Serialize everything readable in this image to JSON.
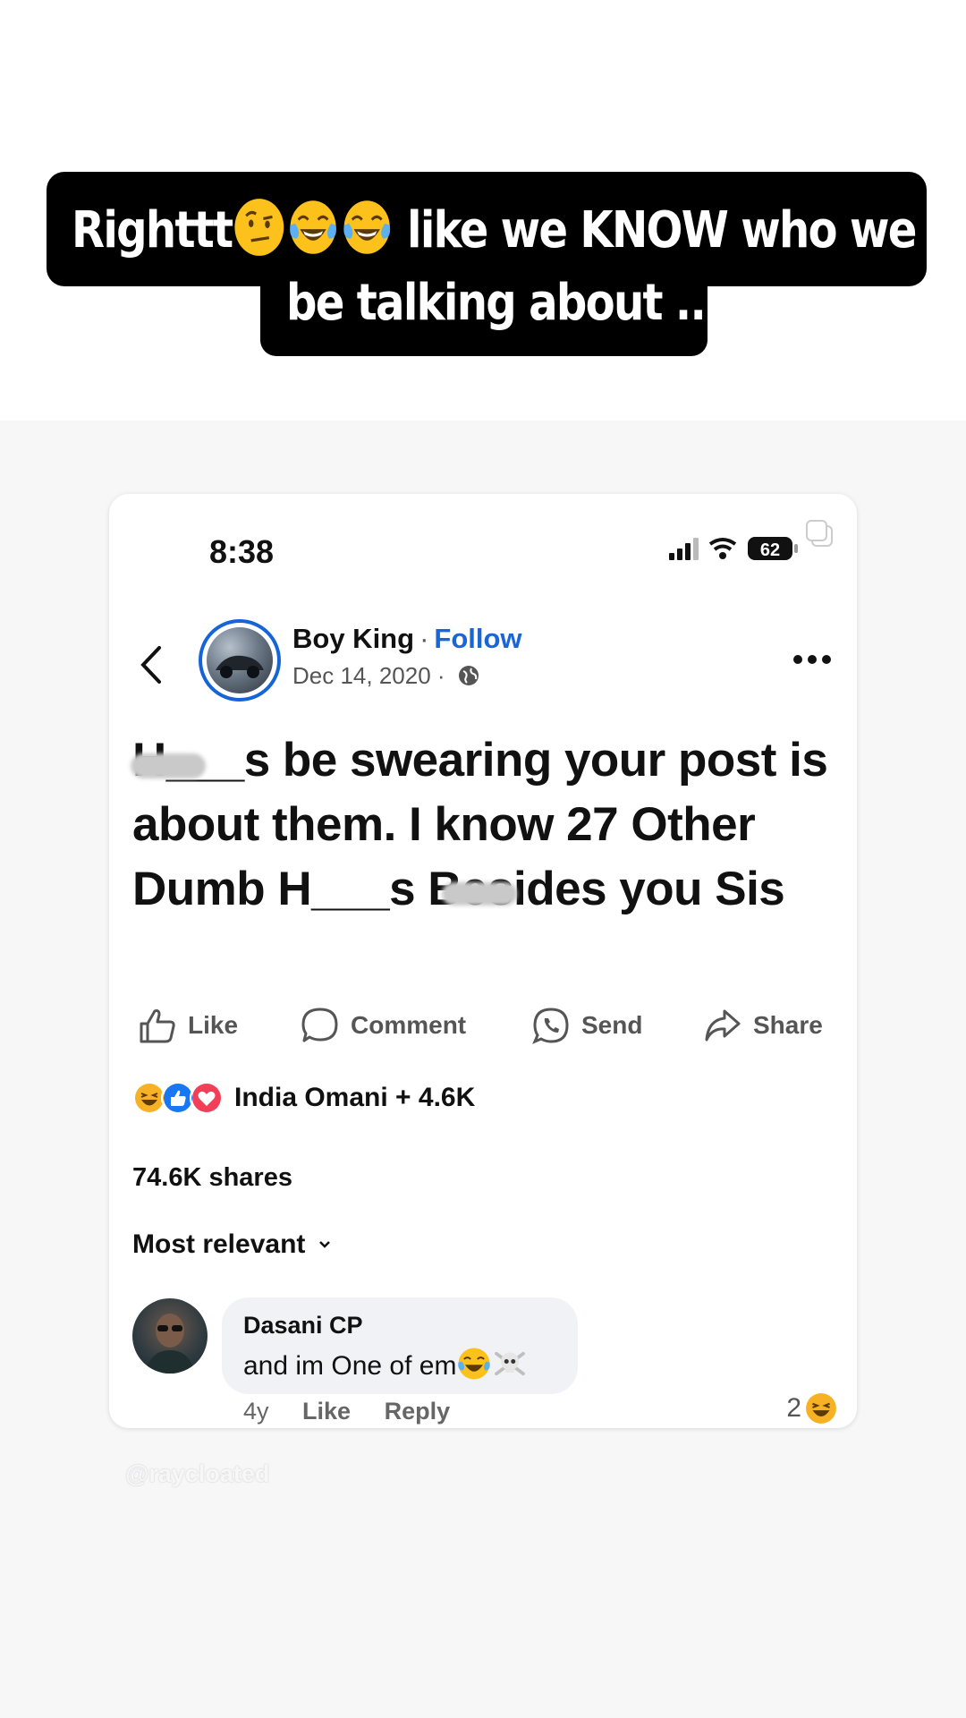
{
  "caption": {
    "line1_start": "Righttt",
    "line1_end": "like we KNOW who we",
    "line2": "be talking about .."
  },
  "status_bar": {
    "time": "8:38",
    "battery": "62"
  },
  "post": {
    "author": "Boy King",
    "separator": "·",
    "follow_label": "Follow",
    "date": "Dec 14, 2020 ·",
    "text": "H___s be swearing your post is about them. I know 27 Other Dumb H___s Besides you Sis"
  },
  "actions": {
    "like": "Like",
    "comment": "Comment",
    "send": "Send",
    "share": "Share"
  },
  "reactions": {
    "text": "India Omani + 4.6K"
  },
  "shares": "74.6K shares",
  "sort": {
    "label": "Most relevant"
  },
  "comment": {
    "name": "Dasani CP",
    "text": "and im One of em",
    "age": "4y",
    "like": "Like",
    "reply": "Reply",
    "reaction_count": "2"
  },
  "watermark": "@raycloated",
  "colors": {
    "accent": "#1a66d6",
    "caption_bg": "#000000",
    "like_blue": "#1877f2",
    "love_red": "#f33e58"
  }
}
